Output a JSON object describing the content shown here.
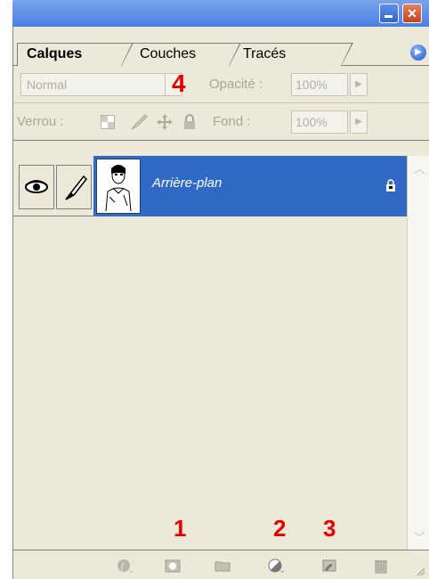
{
  "tabs": [
    {
      "label": "Calques",
      "active": true
    },
    {
      "label": "Couches",
      "active": false
    },
    {
      "label": "Tracés",
      "active": false
    }
  ],
  "blend_mode": {
    "value": "Normal"
  },
  "opacity": {
    "label": "Opacité :",
    "value": "100%"
  },
  "lock": {
    "label": "Verrou :"
  },
  "fill": {
    "label": "Fond :",
    "value": "100%"
  },
  "layers": [
    {
      "name": "Arrière-plan",
      "visible": true,
      "locked": true
    }
  ],
  "annotations": {
    "a1": "1",
    "a2": "2",
    "a3": "3",
    "a4": "4"
  },
  "bottom_icons": [
    "layer-style-icon",
    "layer-mask-icon",
    "layer-set-icon",
    "adjustment-layer-icon",
    "new-layer-icon",
    "trash-icon"
  ],
  "colors": {
    "selection": "#3169c6",
    "panel": "#ece9d8",
    "annotation": "#e60000"
  }
}
